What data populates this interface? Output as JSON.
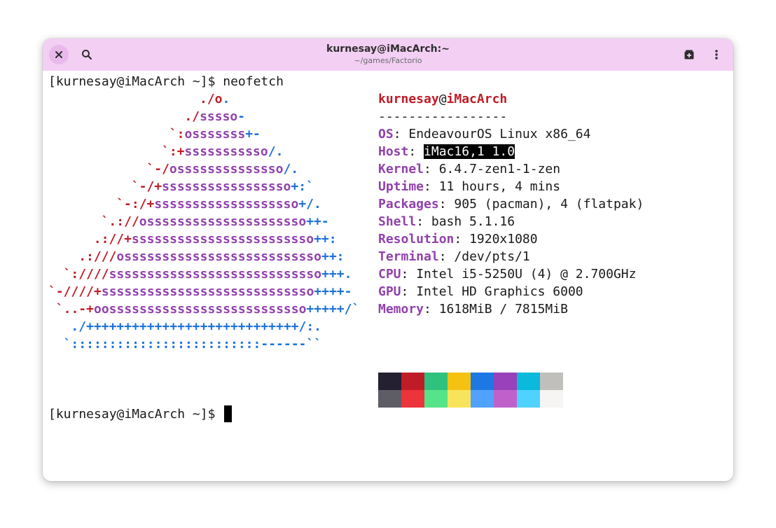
{
  "window": {
    "title": "kurnesay@iMacArch:~",
    "subtitle": "~/games/Factorio"
  },
  "icons": {
    "close": "close-icon",
    "search": "search-icon",
    "new_tab": "new-tab-icon",
    "menu": "kebab-menu-icon"
  },
  "terminal": {
    "prompt_first": "[kurnesay@iMacArch ~]$ neofetch",
    "prompt_last": "[kurnesay@iMacArch ~]$ ",
    "logo_lines": [
      [
        [
          "r",
          "./o"
        ],
        [
          "b",
          "."
        ]
      ],
      [
        [
          "r",
          "./"
        ],
        [
          "p",
          "sssso"
        ],
        [
          "b",
          "-"
        ]
      ],
      [
        [
          "r",
          "`:"
        ],
        [
          "p",
          "osssssss"
        ],
        [
          "b",
          "+-"
        ]
      ],
      [
        [
          "r",
          "`:+"
        ],
        [
          "p",
          "sssssssssso"
        ],
        [
          "b",
          "/."
        ]
      ],
      [
        [
          "r",
          "`-/"
        ],
        [
          "p",
          "ossssssssssssso"
        ],
        [
          "b",
          "/."
        ]
      ],
      [
        [
          "r",
          "`-/+"
        ],
        [
          "p",
          "sssssssssssssssso"
        ],
        [
          "b",
          "+:`"
        ]
      ],
      [
        [
          "r",
          "`-:/+"
        ],
        [
          "p",
          "sssssssssssssssssso"
        ],
        [
          "b",
          "+/."
        ]
      ],
      [
        [
          "r",
          "`.://"
        ],
        [
          "p",
          "osssssssssssssssssssso"
        ],
        [
          "b",
          "++-"
        ]
      ],
      [
        [
          "r",
          ".://+"
        ],
        [
          "p",
          "ssssssssssssssssssssssso"
        ],
        [
          "b",
          "++:"
        ]
      ],
      [
        [
          "r",
          ".:///"
        ],
        [
          "p",
          "ossssssssssssssssssssssssso"
        ],
        [
          "b",
          "++:"
        ]
      ],
      [
        [
          "r",
          "`:////"
        ],
        [
          "p",
          "ssssssssssssssssssssssssssso"
        ],
        [
          "b",
          "+++."
        ]
      ],
      [
        [
          "r",
          "`-////+"
        ],
        [
          "p",
          "ssssssssssssssssssssssssssso"
        ],
        [
          "b",
          "++++-"
        ]
      ],
      [
        [
          "r",
          "`..-+"
        ],
        [
          "p",
          "oossssssssssssssssssssssssso"
        ],
        [
          "b",
          "+++++/`"
        ]
      ],
      [
        [
          "b",
          "./++++++++++++++++++++++++++++/:."
        ]
      ],
      [
        [
          "b",
          "`:::::::::::::::::::::::::------``"
        ]
      ]
    ],
    "logo_offsets": [
      20,
      18,
      16,
      15,
      13,
      11,
      9,
      7,
      6,
      4,
      2,
      0,
      1,
      3,
      2
    ],
    "user": "kurnesay",
    "at": "@",
    "host": "iMacArch",
    "separator": "-----------------",
    "info": [
      {
        "label": "OS",
        "value": "EndeavourOS Linux x86_64"
      },
      {
        "label": "Host",
        "value": "iMac16,1 1.0",
        "highlight": true
      },
      {
        "label": "Kernel",
        "value": "6.4.7-zen1-1-zen"
      },
      {
        "label": "Uptime",
        "value": "11 hours, 4 mins"
      },
      {
        "label": "Packages",
        "value": "905 (pacman), 4 (flatpak)"
      },
      {
        "label": "Shell",
        "value": "bash 5.1.16"
      },
      {
        "label": "Resolution",
        "value": "1920x1080"
      },
      {
        "label": "Terminal",
        "value": "/dev/pts/1"
      },
      {
        "label": "CPU",
        "value": "Intel i5-5250U (4) @ 2.700GHz"
      },
      {
        "label": "GPU",
        "value": "Intel HD Graphics 6000"
      },
      {
        "label": "Memory",
        "value": "1618MiB / 7815MiB"
      }
    ],
    "palette_top": [
      "#241f31",
      "#c01c28",
      "#2ec27e",
      "#f5c211",
      "#1e78e4",
      "#9841bb",
      "#0ab9dc",
      "#c0bfbc"
    ],
    "palette_bottom": [
      "#5e5c64",
      "#ed333b",
      "#57e389",
      "#f8e45c",
      "#51a1ff",
      "#c061cb",
      "#4fd2fd",
      "#f6f5f4"
    ]
  }
}
